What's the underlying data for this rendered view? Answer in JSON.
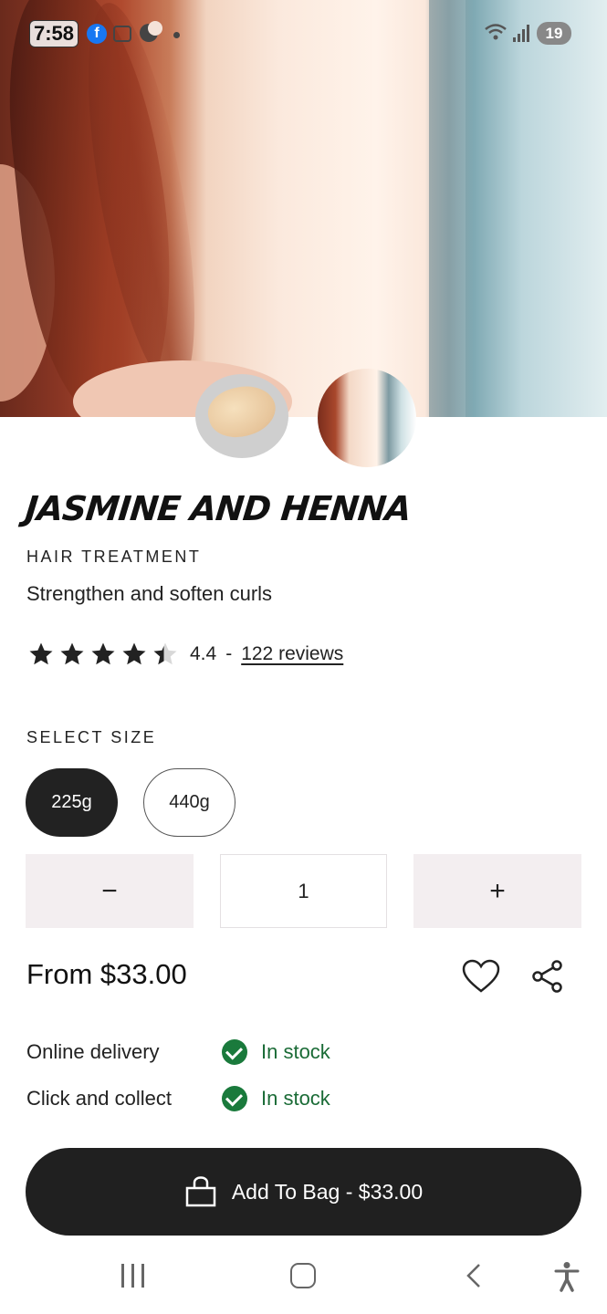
{
  "status_bar": {
    "time": "7:58",
    "battery": "19",
    "icons": [
      "facebook-icon",
      "screenshot-icon",
      "dnd-moon-icon",
      "notification-dot-icon",
      "wifi-icon",
      "signal-icon",
      "battery-icon"
    ]
  },
  "product": {
    "title": "JASMINE AND HENNA",
    "category": "HAIR TREATMENT",
    "tagline": "Strengthen and soften curls",
    "rating": {
      "stars": 4.4,
      "value_label": "4.4",
      "separator": "-",
      "reviews_label": "122 reviews"
    },
    "select_size_label": "SELECT SIZE",
    "sizes": [
      {
        "label": "225g",
        "selected": true
      },
      {
        "label": "440g",
        "selected": false
      }
    ],
    "quantity": {
      "minus_label": "−",
      "value": "1",
      "plus_label": "+"
    },
    "price_label": "From $33.00",
    "availability": [
      {
        "label": "Online delivery",
        "status": "In stock"
      },
      {
        "label": "Click and collect",
        "status": "In stock"
      }
    ],
    "add_to_bag_label": "Add To Bag - $33.00"
  },
  "colors": {
    "primary_dark": "#202020",
    "stock_green": "#1a7a3c",
    "qty_button_bg": "#f3eef0"
  },
  "navigation": {
    "icons": [
      "recent-apps-icon",
      "home-icon",
      "back-icon",
      "accessibility-icon"
    ]
  }
}
